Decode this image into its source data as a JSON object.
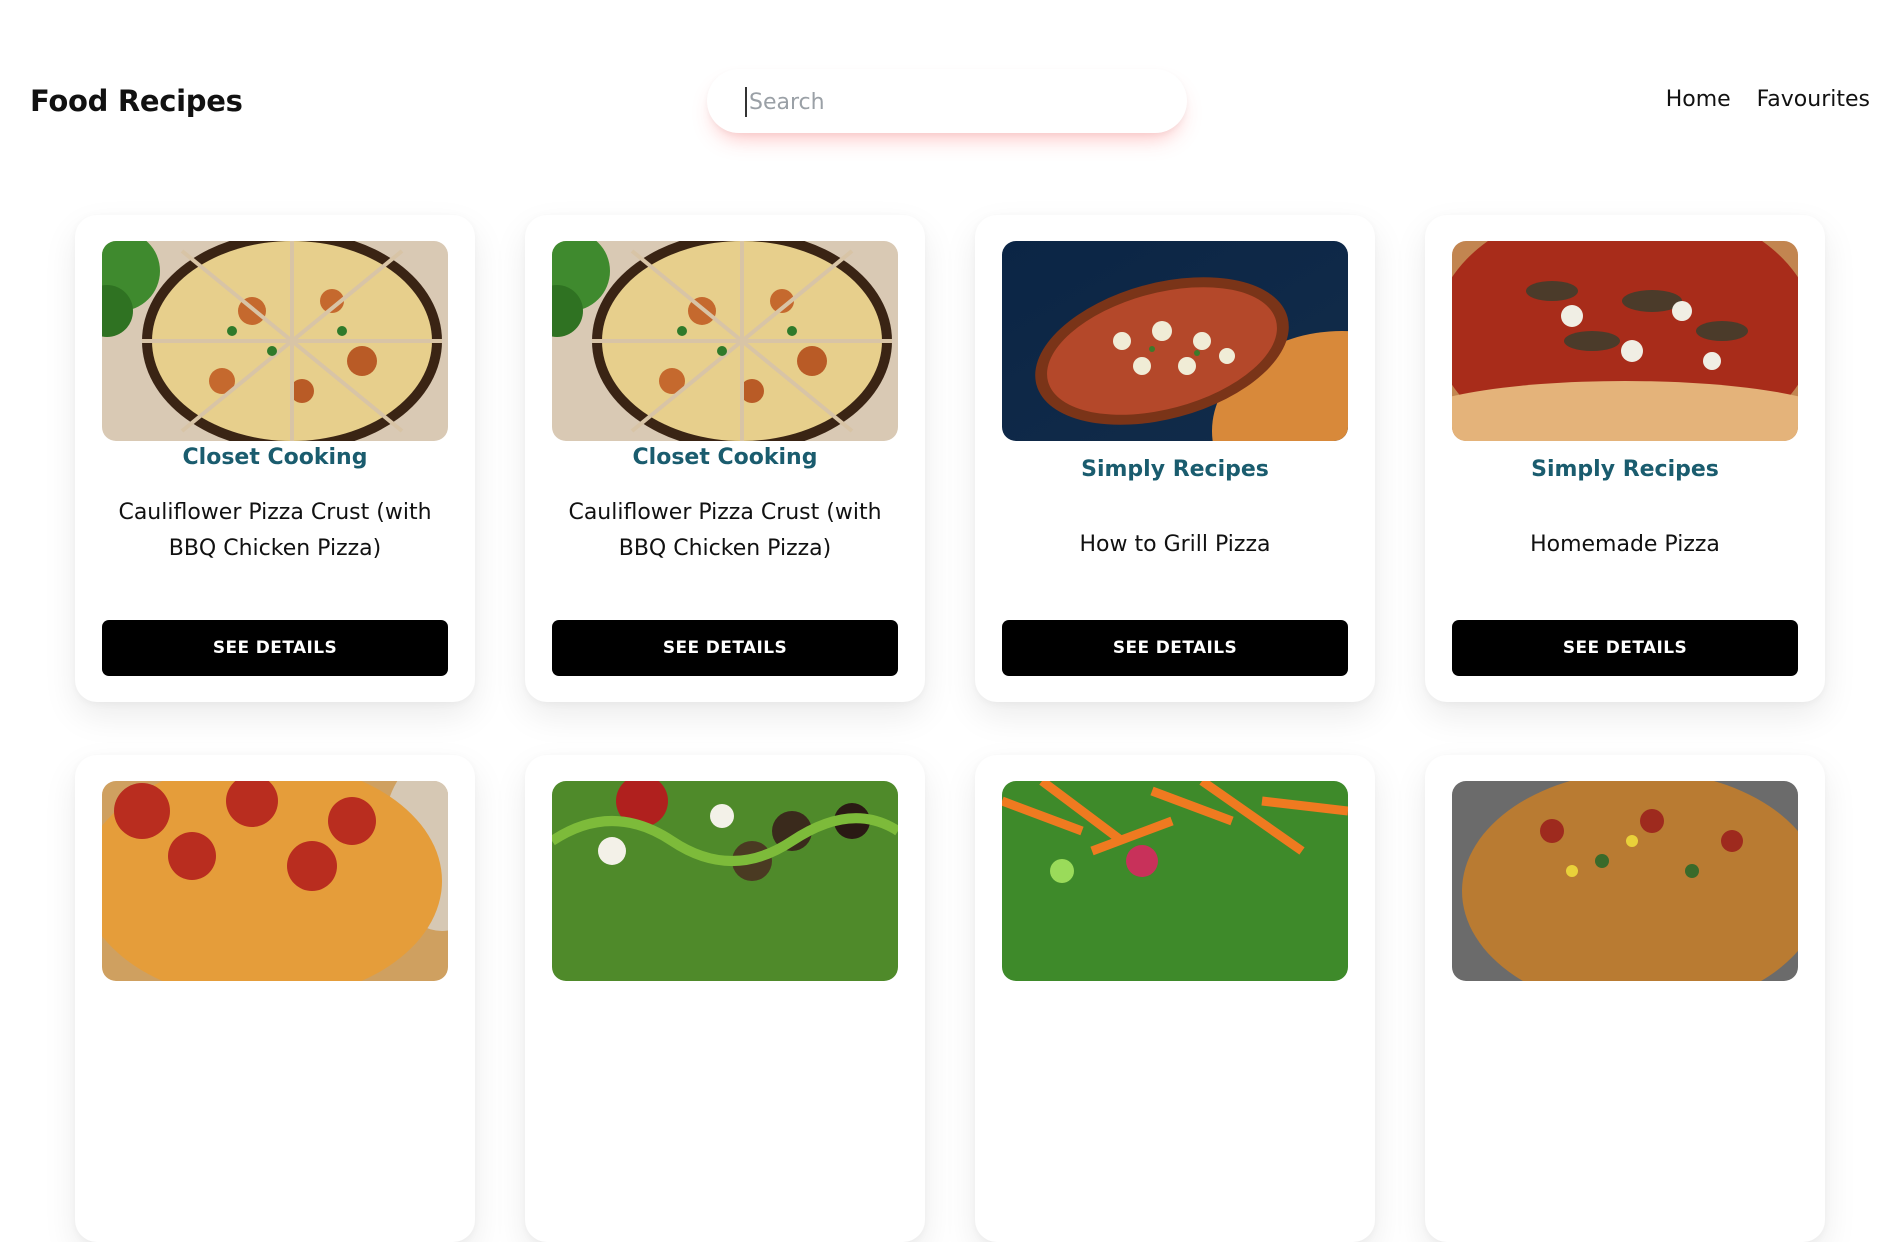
{
  "header": {
    "brand": "Food Recipes",
    "search_placeholder": "Search",
    "nav": [
      "Home",
      "Favourites"
    ]
  },
  "cards": [
    {
      "publisher": "Closet Cooking",
      "title": "Cauliflower Pizza Crust (with BBQ Chicken Pizza)",
      "button": "SEE DETAILS",
      "image": "bbq-chicken-pizza-image"
    },
    {
      "publisher": "Closet Cooking",
      "title": "Cauliflower Pizza Crust (with BBQ Chicken Pizza)",
      "button": "SEE DETAILS",
      "image": "bbq-chicken-pizza-image"
    },
    {
      "publisher": "Simply Recipes",
      "title": "How to Grill Pizza",
      "button": "SEE DETAILS",
      "image": "grilled-pizza-image"
    },
    {
      "publisher": "Simply Recipes",
      "title": "Homemade Pizza",
      "button": "SEE DETAILS",
      "image": "homemade-pizza-image"
    },
    {
      "image": "pepperoni-pizza-image"
    },
    {
      "image": "salad-image"
    },
    {
      "image": "carrot-salad-image"
    },
    {
      "image": "veggie-pizza-image"
    }
  ]
}
